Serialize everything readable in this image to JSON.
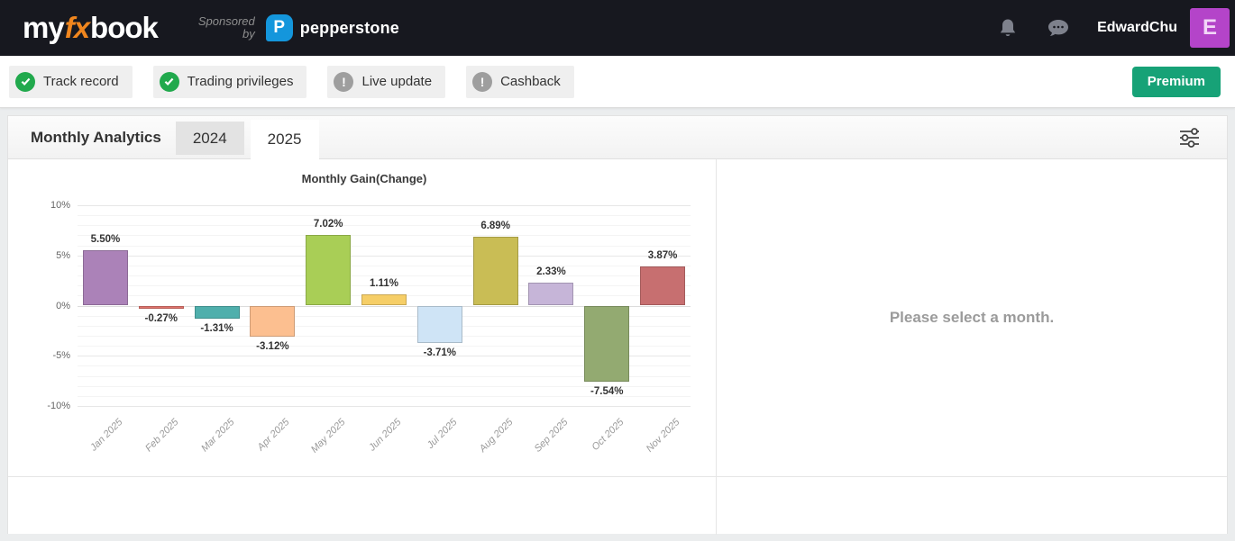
{
  "header": {
    "logo_my": "my",
    "logo_fx": "fx",
    "logo_book": "book",
    "logo_fx_color": "#f0861e",
    "sponsored_line1": "Sponsored",
    "sponsored_line2": "by",
    "sponsor_initial": "P",
    "sponsor_name": "pepperstone",
    "sponsor_brand_color": "#1496dc",
    "username": "EdwardChu",
    "avatar_letter": "E",
    "avatar_color": "#b444c9",
    "navbar_color": "#17181f"
  },
  "status_bar": {
    "badges": [
      {
        "label": "Track record",
        "status": "ok"
      },
      {
        "label": "Trading privileges",
        "status": "ok"
      },
      {
        "label": "Live update",
        "status": "off"
      },
      {
        "label": "Cashback",
        "status": "off"
      }
    ],
    "status_colors": {
      "ok": "#21a94d",
      "off": "#9e9e9e"
    },
    "premium_label": "Premium",
    "premium_color": "#17a277"
  },
  "analytics": {
    "section_title": "Monthly Analytics",
    "tabs": [
      {
        "label": "2024",
        "active": false
      },
      {
        "label": "2025",
        "active": true
      }
    ],
    "placeholder_text": "Please select a month."
  },
  "chart_data": {
    "type": "bar",
    "title": "Monthly Gain(Change)",
    "categories": [
      "Jan 2025",
      "Feb 2025",
      "Mar 2025",
      "Apr 2025",
      "May 2025",
      "Jun 2025",
      "Jul 2025",
      "Aug 2025",
      "Sep 2025",
      "Oct 2025",
      "Nov 2025"
    ],
    "values": [
      5.5,
      -0.27,
      -1.31,
      -3.12,
      7.02,
      1.11,
      -3.71,
      6.89,
      2.33,
      -7.54,
      3.87
    ],
    "value_label_format": "{value}%",
    "colors": [
      "#ab82b8",
      "#e0736c",
      "#4fafac",
      "#fcbf90",
      "#a9ce56",
      "#f6ce67",
      "#cfe4f6",
      "#c9bd55",
      "#c6b5d8",
      "#93aa71",
      "#c76f70"
    ],
    "xlabel": "",
    "ylabel": "",
    "ylim": [
      -10,
      10
    ],
    "y_ticks": [
      10,
      5,
      0,
      -5,
      -10
    ],
    "y_tick_suffix": "%",
    "minor_grid_step": 1,
    "grid": true,
    "legend": false
  }
}
